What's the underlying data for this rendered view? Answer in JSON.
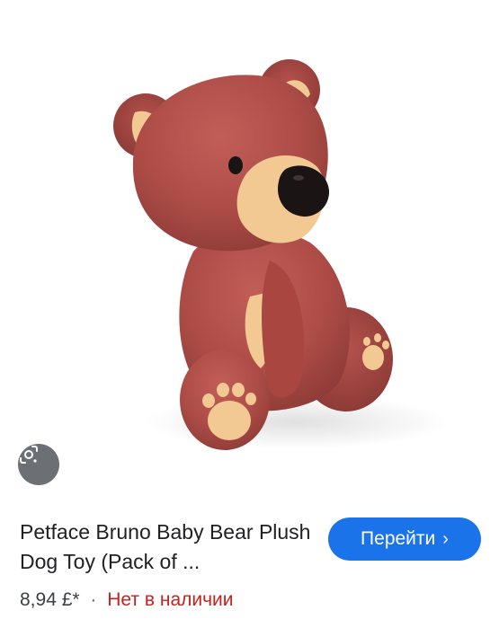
{
  "product": {
    "image_alt": "Brown plush teddy bear dog toy",
    "title": "Petface Bruno Baby Bear Plush Dog Toy (Pack of ...",
    "price": "8,94 £*",
    "separator": "·",
    "availability": "Нет в наличии"
  },
  "actions": {
    "go_label": "Перейти",
    "go_chevron": "›",
    "lens_icon": "lens-search-icon"
  },
  "colors": {
    "go_button": "#1a73e8",
    "availability": "#c5221f",
    "bear_fur": "#b24f4a",
    "bear_muzzle": "#f2c893"
  }
}
